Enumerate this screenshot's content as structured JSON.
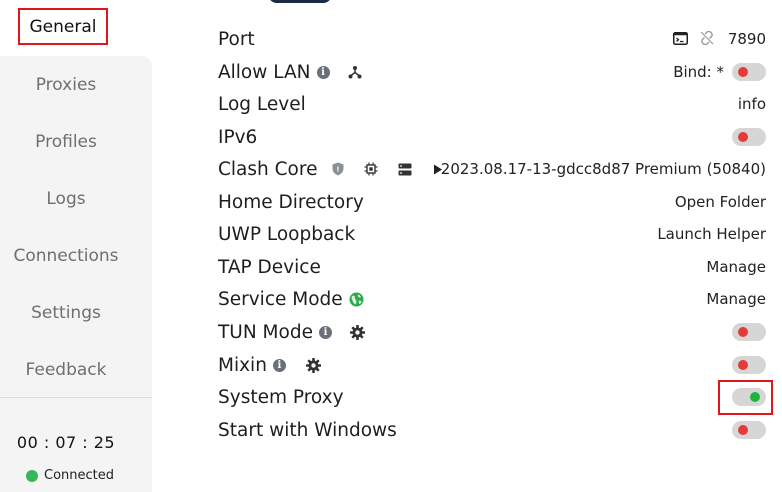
{
  "sidebar": {
    "active": "General",
    "items": [
      "Proxies",
      "Profiles",
      "Logs",
      "Connections",
      "Settings",
      "Feedback"
    ],
    "timer": "00 : 07 : 25",
    "status": "Connected"
  },
  "settings": {
    "port": {
      "label": "Port",
      "value": "7890"
    },
    "allow_lan": {
      "label": "Allow LAN",
      "bind": "Bind: *",
      "enabled": false
    },
    "log_level": {
      "label": "Log Level",
      "value": "info"
    },
    "ipv6": {
      "label": "IPv6",
      "enabled": false
    },
    "clash_core": {
      "label": "Clash Core",
      "version": "2023.08.17-13-gdcc8d87 Premium (50840)"
    },
    "home_directory": {
      "label": "Home Directory",
      "action": "Open Folder"
    },
    "uwp_loopback": {
      "label": "UWP Loopback",
      "action": "Launch Helper"
    },
    "tap_device": {
      "label": "TAP Device",
      "action": "Manage"
    },
    "service_mode": {
      "label": "Service Mode",
      "action": "Manage"
    },
    "tun_mode": {
      "label": "TUN Mode",
      "enabled": false
    },
    "mixin": {
      "label": "Mixin",
      "enabled": false
    },
    "system_proxy": {
      "label": "System Proxy",
      "enabled": true
    },
    "start_with_windows": {
      "label": "Start with Windows",
      "enabled": false
    }
  },
  "colors": {
    "highlight": "#e0161c",
    "toggle_off_knob": "#e53a3a",
    "toggle_on_knob": "#1fb53c",
    "connected": "#35b85a",
    "globe": "#2fa84f"
  },
  "icons": {
    "info": "info-circle-icon",
    "lan": "network-share-icon",
    "terminal": "terminal-icon",
    "unlink": "unlink-icon",
    "shield": "shield-icon",
    "chip": "cpu-chip-icon",
    "server": "server-icon",
    "play": "play-icon",
    "globe": "globe-icon",
    "gear": "gear-icon"
  }
}
